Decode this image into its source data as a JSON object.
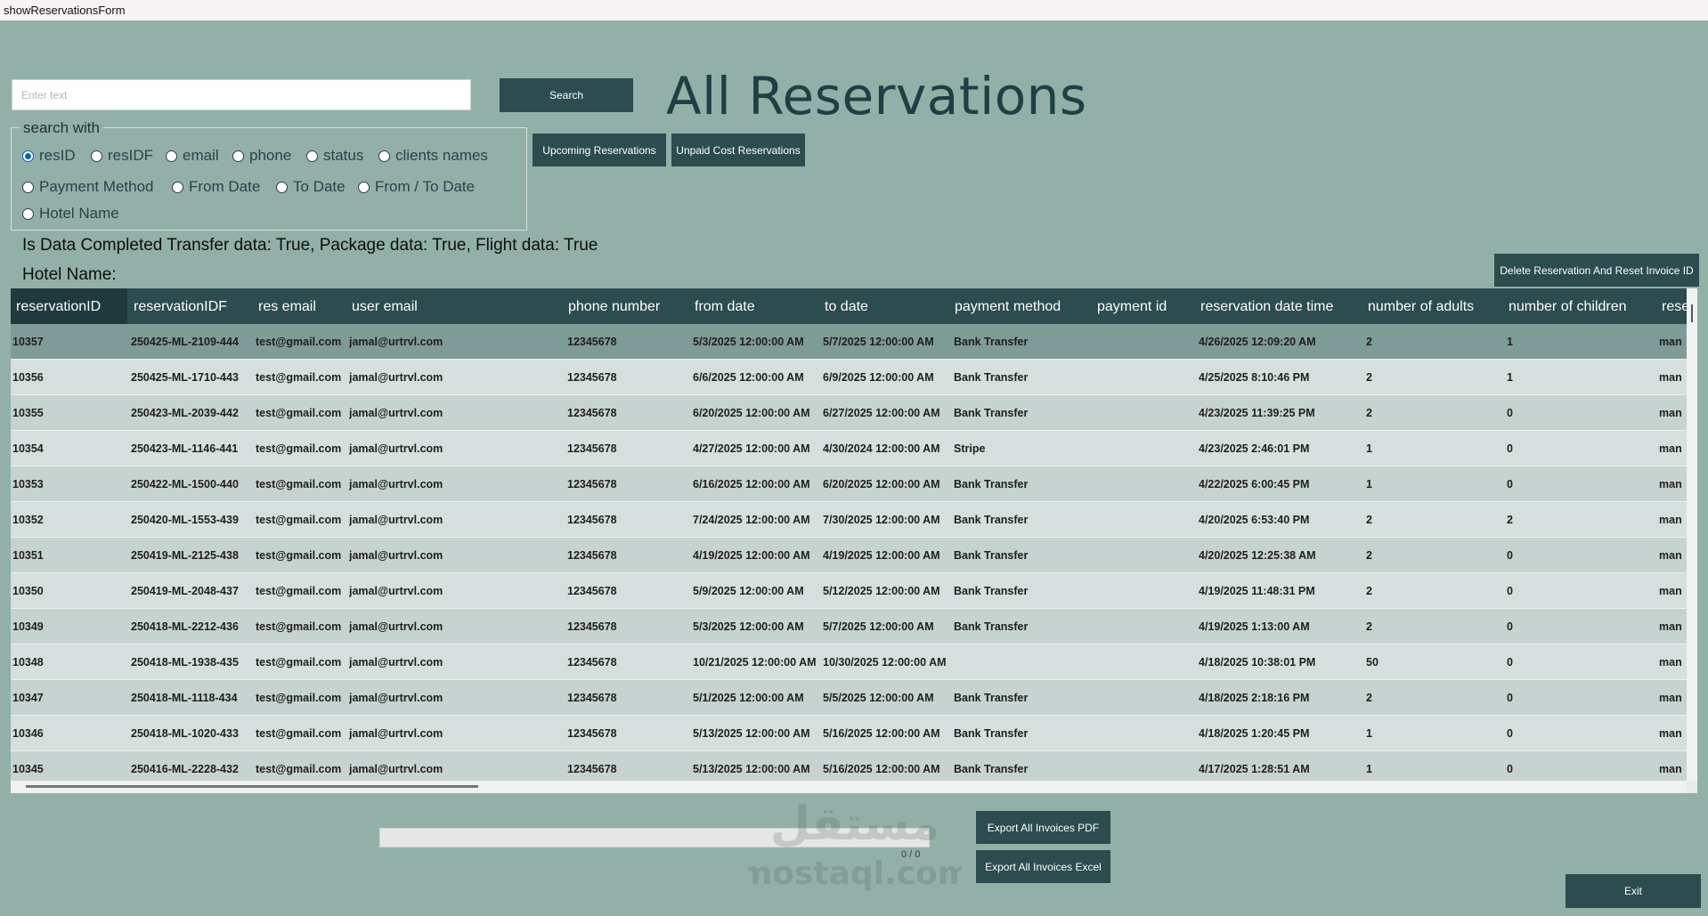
{
  "window": {
    "title": "showReservationsForm"
  },
  "search": {
    "placeholder": "Enter text",
    "value": "",
    "button_label": "Search"
  },
  "page_title": "All Reservations",
  "filters": {
    "upcoming_label": "Upcoming Reservations",
    "unpaid_label": "Unpaid Cost Reservations"
  },
  "search_with": {
    "legend": "search with",
    "options": [
      {
        "label": "resID",
        "checked": true
      },
      {
        "label": "resIDF",
        "checked": false
      },
      {
        "label": "email",
        "checked": false
      },
      {
        "label": "phone",
        "checked": false
      },
      {
        "label": "status",
        "checked": false
      },
      {
        "label": "clients names",
        "checked": false
      },
      {
        "label": "Payment Method",
        "checked": false
      },
      {
        "label": "From Date",
        "checked": false
      },
      {
        "label": "To Date",
        "checked": false
      },
      {
        "label": "From /  To Date",
        "checked": false
      },
      {
        "label": "Hotel Name",
        "checked": false
      }
    ]
  },
  "status_info": {
    "data_completed": "Is Data Completed  Transfer data: True, Package data: True, Flight data: True",
    "hotel_name": "Hotel Name:"
  },
  "delete_button_label": "Delete Reservation And Reset Invoice ID",
  "table": {
    "columns": [
      "reservationID",
      "reservationIDF",
      "res email",
      "user email",
      "phone number",
      "from date",
      "to date",
      "payment method",
      "payment id",
      "reservation date time",
      "number of adults",
      "number of children",
      "rese"
    ],
    "rows": [
      [
        "10357",
        "250425-ML-2109-444",
        "test@gmail.com",
        "jamal@urtrvl.com",
        "12345678",
        "5/3/2025 12:00:00 AM",
        "5/7/2025 12:00:00 AM",
        "Bank Transfer",
        "",
        "4/26/2025 12:09:20 AM",
        "2",
        "1",
        "man"
      ],
      [
        "10356",
        "250425-ML-1710-443",
        "test@gmail.com",
        "jamal@urtrvl.com",
        "12345678",
        "6/6/2025 12:00:00 AM",
        "6/9/2025 12:00:00 AM",
        "Bank Transfer",
        "",
        "4/25/2025 8:10:46 PM",
        "2",
        "1",
        "man"
      ],
      [
        "10355",
        "250423-ML-2039-442",
        "test@gmail.com",
        "jamal@urtrvl.com",
        "12345678",
        "6/20/2025 12:00:00 AM",
        "6/27/2025 12:00:00 AM",
        "Bank Transfer",
        "",
        "4/23/2025 11:39:25 PM",
        "2",
        "0",
        "man"
      ],
      [
        "10354",
        "250423-ML-1146-441",
        "test@gmail.com",
        "jamal@urtrvl.com",
        "12345678",
        "4/27/2025 12:00:00 AM",
        "4/30/2024 12:00:00 AM",
        "Stripe",
        "",
        "4/23/2025 2:46:01 PM",
        "1",
        "0",
        "man"
      ],
      [
        "10353",
        "250422-ML-1500-440",
        "test@gmail.com",
        "jamal@urtrvl.com",
        "12345678",
        "6/16/2025 12:00:00 AM",
        "6/20/2025 12:00:00 AM",
        "Bank Transfer",
        "",
        "4/22/2025 6:00:45 PM",
        "1",
        "0",
        "man"
      ],
      [
        "10352",
        "250420-ML-1553-439",
        "test@gmail.com",
        "jamal@urtrvl.com",
        "12345678",
        "7/24/2025 12:00:00 AM",
        "7/30/2025 12:00:00 AM",
        "Bank Transfer",
        "",
        "4/20/2025 6:53:40 PM",
        "2",
        "2",
        "man"
      ],
      [
        "10351",
        "250419-ML-2125-438",
        "test@gmail.com",
        "jamal@urtrvl.com",
        "12345678",
        "4/19/2025 12:00:00 AM",
        "4/19/2025 12:00:00 AM",
        "Bank Transfer",
        "",
        "4/20/2025 12:25:38 AM",
        "2",
        "0",
        "man"
      ],
      [
        "10350",
        "250419-ML-2048-437",
        "test@gmail.com",
        "jamal@urtrvl.com",
        "12345678",
        "5/9/2025 12:00:00 AM",
        "5/12/2025 12:00:00 AM",
        "Bank Transfer",
        "",
        "4/19/2025 11:48:31 PM",
        "2",
        "0",
        "man"
      ],
      [
        "10349",
        "250418-ML-2212-436",
        "test@gmail.com",
        "jamal@urtrvl.com",
        "12345678",
        "5/3/2025 12:00:00 AM",
        "5/7/2025 12:00:00 AM",
        "Bank Transfer",
        "",
        "4/19/2025 1:13:00 AM",
        "2",
        "0",
        "man"
      ],
      [
        "10348",
        "250418-ML-1938-435",
        "test@gmail.com",
        "jamal@urtrvl.com",
        "12345678",
        "10/21/2025 12:00:00 AM",
        "10/30/2025 12:00:00 AM",
        "",
        "",
        "4/18/2025 10:38:01 PM",
        "50",
        "0",
        "man"
      ],
      [
        "10347",
        "250418-ML-1118-434",
        "test@gmail.com",
        "jamal@urtrvl.com",
        "12345678",
        "5/1/2025 12:00:00 AM",
        "5/5/2025 12:00:00 AM",
        "Bank Transfer",
        "",
        "4/18/2025 2:18:16 PM",
        "2",
        "0",
        "man"
      ],
      [
        "10346",
        "250418-ML-1020-433",
        "test@gmail.com",
        "jamal@urtrvl.com",
        "12345678",
        "5/13/2025 12:00:00 AM",
        "5/16/2025 12:00:00 AM",
        "Bank Transfer",
        "",
        "4/18/2025 1:20:45 PM",
        "1",
        "0",
        "man"
      ],
      [
        "10345",
        "250416-ML-2228-432",
        "test@gmail.com",
        "jamal@urtrvl.com",
        "12345678",
        "5/13/2025 12:00:00 AM",
        "5/16/2025 12:00:00 AM",
        "Bank Transfer",
        "",
        "4/17/2025 1:28:51 AM",
        "1",
        "0",
        "man"
      ]
    ]
  },
  "export": {
    "progress_fraction": 0,
    "progress_text": "0 / 0",
    "pdf_label": "Export All Invoices PDF",
    "excel_label": "Export All Invoices Excel"
  },
  "exit_label": "Exit",
  "watermark": {
    "text": "mostaql.com",
    "arabic_text": "مستقل"
  },
  "colors": {
    "background": "#92b0a8",
    "button": "#2c4c4f",
    "header": "#2c4c4f",
    "selected_row": "#7f9b97",
    "radio_checked": "#0a5fbf"
  }
}
